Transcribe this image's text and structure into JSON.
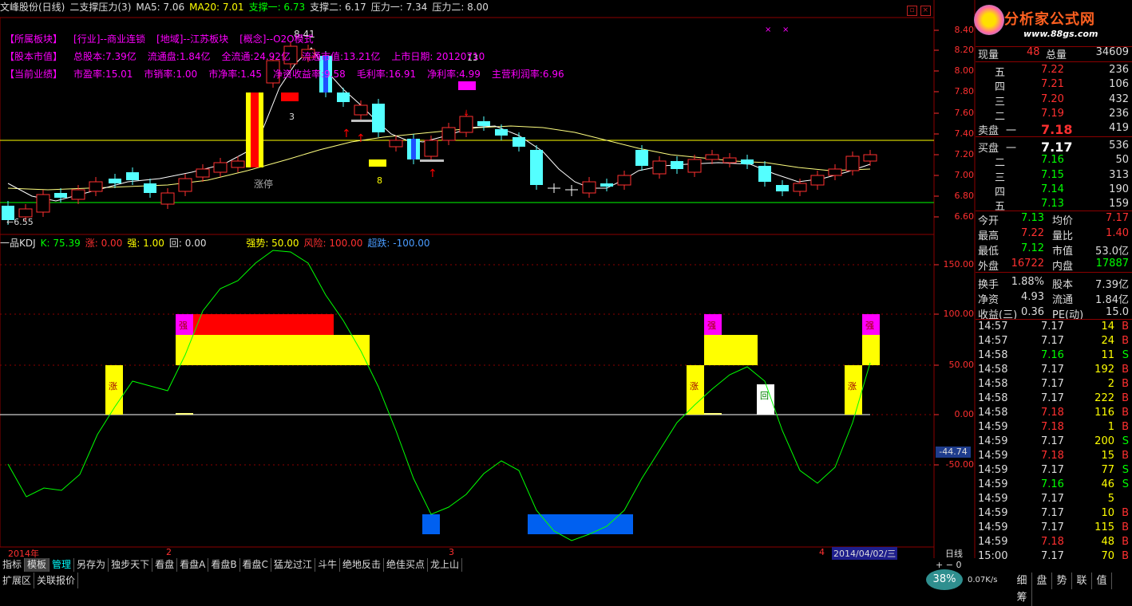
{
  "header": {
    "title": "文峰股份(日线)",
    "indicator": "二支撑压力(3)",
    "ma5": "MA5: 7.06",
    "ma20": "MA20: 7.01",
    "support1": "支撑一: 6.73",
    "support2": "支撑二: 6.17",
    "resist1": "压力一: 7.34",
    "resist2": "压力二: 8.00"
  },
  "info": {
    "row1": [
      "【所属板块】",
      "[行业]--商业连锁",
      "[地域]--江苏板块",
      "[概念]--O2O模式"
    ],
    "row2": [
      "【股本市值】",
      "总股本:7.39亿",
      "流通盘:1.84亿",
      "全流通:24.92亿",
      "流通市值:13.21亿",
      "上市日期: 20120710"
    ],
    "row3": [
      "【当前业绩】",
      "市盈率:15.01",
      "市销率:1.00",
      "市净率:1.45",
      "净资收益率:9.58",
      "毛利率:16.91",
      "净利率:4.99",
      "主营利润率:6.96"
    ]
  },
  "chart_labels": {
    "high_price": "8.41",
    "low_price": "6.55",
    "zhangting": "涨停",
    "num3": "3",
    "num8": "8",
    "num13": "13"
  },
  "kdj": {
    "name": "一品KDJ",
    "k": "K: 75.39",
    "zhang": "涨: 0.00",
    "qiang": "强: 1.00",
    "hui": "回: 0.00",
    "qiangshi": "强势: 50.00",
    "fengxian": "风险: 100.00",
    "chaodie": "超跌: -100.00",
    "cursor_value": "-44.74"
  },
  "price_axis": [
    "8.40",
    "8.20",
    "8.00",
    "7.80",
    "7.60",
    "7.40",
    "7.20",
    "7.00",
    "6.80",
    "6.60"
  ],
  "kdj_axis": [
    "150.00",
    "100.00",
    "50.00",
    "0.00",
    "-50.00"
  ],
  "dates": {
    "d1": "2014年",
    "d2": "2",
    "d3": "3",
    "d4": "4",
    "current": "2014/04/02/三",
    "period": "日线"
  },
  "toolbar": [
    "指标",
    "模板",
    "管理",
    "另存为",
    "独步天下",
    "看盘",
    "看盘A",
    "看盘B",
    "看盘C",
    "猛龙过江",
    "斗牛",
    "绝地反击",
    "绝佳买点",
    "龙上山"
  ],
  "toolbar2": [
    "扩展区",
    "关联报价"
  ],
  "right_tabs": [
    "细",
    "盘",
    "势",
    "联",
    "值",
    "筹"
  ],
  "logo": {
    "text": "分析家公式网",
    "url": "www.88gs.com"
  },
  "status": {
    "percent": "38%",
    "speed": "0.07K/s"
  },
  "quote": {
    "xianliang_label": "现量",
    "xianliang": "48",
    "zongliang_label": "总量",
    "zongliang": "34609",
    "sell": [
      {
        "label": "五",
        "price": "7.22",
        "vol": "236"
      },
      {
        "label": "四",
        "price": "7.21",
        "vol": "106"
      },
      {
        "label": "三",
        "price": "7.20",
        "vol": "432"
      },
      {
        "label": "二",
        "price": "7.19",
        "vol": "236"
      },
      {
        "label": "一",
        "price": "7.18",
        "vol": "419"
      }
    ],
    "sell_label": "卖盘",
    "buy_label": "买盘",
    "buy": [
      {
        "label": "一",
        "price": "7.17",
        "vol": "536"
      },
      {
        "label": "二",
        "price": "7.16",
        "vol": "50"
      },
      {
        "label": "三",
        "price": "7.15",
        "vol": "313"
      },
      {
        "label": "四",
        "price": "7.14",
        "vol": "190"
      },
      {
        "label": "五",
        "price": "7.13",
        "vol": "159"
      }
    ],
    "stats": [
      {
        "l1": "今开",
        "v1": "7.13",
        "c1": "#00ff00",
        "l2": "均价",
        "v2": "7.17",
        "c2": "#ff3030"
      },
      {
        "l1": "最高",
        "v1": "7.22",
        "c1": "#ff3030",
        "l2": "量比",
        "v2": "1.40",
        "c2": "#ff3030"
      },
      {
        "l1": "最低",
        "v1": "7.12",
        "c1": "#00ff00",
        "l2": "市值",
        "v2": "53.0亿",
        "c2": "#dddddd"
      },
      {
        "l1": "外盘",
        "v1": "16722",
        "c1": "#ff3030",
        "l2": "内盘",
        "v2": "17887",
        "c2": "#00ff00"
      },
      {
        "l1": "换手",
        "v1": "1.88%",
        "c1": "#dddddd",
        "l2": "股本",
        "v2": "7.39亿",
        "c2": "#dddddd"
      },
      {
        "l1": "净资",
        "v1": "4.93",
        "c1": "#dddddd",
        "l2": "流通",
        "v2": "1.84亿",
        "c2": "#dddddd"
      },
      {
        "l1": "收益(三)",
        "v1": "0.36",
        "c1": "#dddddd",
        "l2": "PE(动)",
        "v2": "15.0",
        "c2": "#dddddd"
      }
    ],
    "ticks": [
      {
        "t": "14:57",
        "p": "7.17",
        "pc": "#dddddd",
        "v": "14",
        "s": "B"
      },
      {
        "t": "14:57",
        "p": "7.17",
        "pc": "#dddddd",
        "v": "24",
        "s": "B"
      },
      {
        "t": "14:58",
        "p": "7.16",
        "pc": "#00ff00",
        "v": "11",
        "s": "S"
      },
      {
        "t": "14:58",
        "p": "7.17",
        "pc": "#dddddd",
        "v": "192",
        "s": "B"
      },
      {
        "t": "14:58",
        "p": "7.17",
        "pc": "#dddddd",
        "v": "2",
        "s": "B"
      },
      {
        "t": "14:58",
        "p": "7.17",
        "pc": "#dddddd",
        "v": "222",
        "s": "B"
      },
      {
        "t": "14:58",
        "p": "7.18",
        "pc": "#ff3030",
        "v": "116",
        "s": "B"
      },
      {
        "t": "14:59",
        "p": "7.18",
        "pc": "#ff3030",
        "v": "1",
        "s": "B"
      },
      {
        "t": "14:59",
        "p": "7.17",
        "pc": "#dddddd",
        "v": "200",
        "s": "S"
      },
      {
        "t": "14:59",
        "p": "7.18",
        "pc": "#ff3030",
        "v": "15",
        "s": "B"
      },
      {
        "t": "14:59",
        "p": "7.17",
        "pc": "#dddddd",
        "v": "77",
        "s": "S"
      },
      {
        "t": "14:59",
        "p": "7.16",
        "pc": "#00ff00",
        "v": "46",
        "s": "S"
      },
      {
        "t": "14:59",
        "p": "7.17",
        "pc": "#dddddd",
        "v": "5",
        "s": ""
      },
      {
        "t": "14:59",
        "p": "7.17",
        "pc": "#dddddd",
        "v": "10",
        "s": "B"
      },
      {
        "t": "14:59",
        "p": "7.17",
        "pc": "#dddddd",
        "v": "115",
        "s": "B"
      },
      {
        "t": "14:59",
        "p": "7.18",
        "pc": "#ff3030",
        "v": "48",
        "s": "B"
      },
      {
        "t": "15:00",
        "p": "7.17",
        "pc": "#dddddd",
        "v": "70",
        "s": "B"
      }
    ]
  }
}
